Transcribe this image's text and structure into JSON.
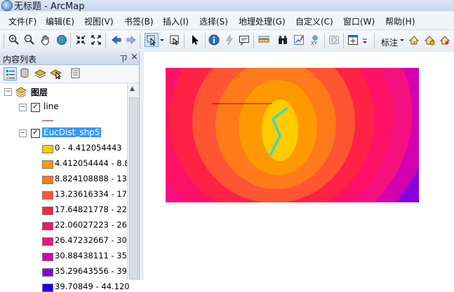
{
  "window": {
    "title": "无标题 - ArcMap"
  },
  "menu": [
    "文件(F)",
    "编辑(E)",
    "视图(V)",
    "书签(B)",
    "插入(I)",
    "选择(S)",
    "地理处理(G)",
    "自定义(C)",
    "窗口(W)",
    "帮助(H)"
  ],
  "toolbar": {
    "label_tool": "标注"
  },
  "toc": {
    "title": "内容列表",
    "pin": "ㄗ",
    "close": "×",
    "root": "图层",
    "layers": [
      {
        "name": "line",
        "checked": true
      },
      {
        "name": "EucDist_shp5",
        "checked": true
      }
    ],
    "classes": [
      {
        "label": "0 - 4.412054443",
        "color": "#ffcc00"
      },
      {
        "label": "4.412054444 - 8.8",
        "color": "#ff9900"
      },
      {
        "label": "8.824108888 - 13.",
        "color": "#ff7a1a"
      },
      {
        "label": "13.23616334 - 17.",
        "color": "#ff5533"
      },
      {
        "label": "17.64821778 - 22.",
        "color": "#ff2244"
      },
      {
        "label": "22.06027223 - 26.",
        "color": "#ff1166"
      },
      {
        "label": "26.47232667 - 30.",
        "color": "#f5107f"
      },
      {
        "label": "30.88438111 - 35.",
        "color": "#d400b0"
      },
      {
        "label": "35.29643556 - 39.",
        "color": "#8800dd"
      },
      {
        "label": "39.70849 - 44.120",
        "color": "#1400ff"
      }
    ]
  },
  "colors": {
    "selection": "#3399ff",
    "line_layer": "#7a1040",
    "feature_line": "#22dddd"
  }
}
